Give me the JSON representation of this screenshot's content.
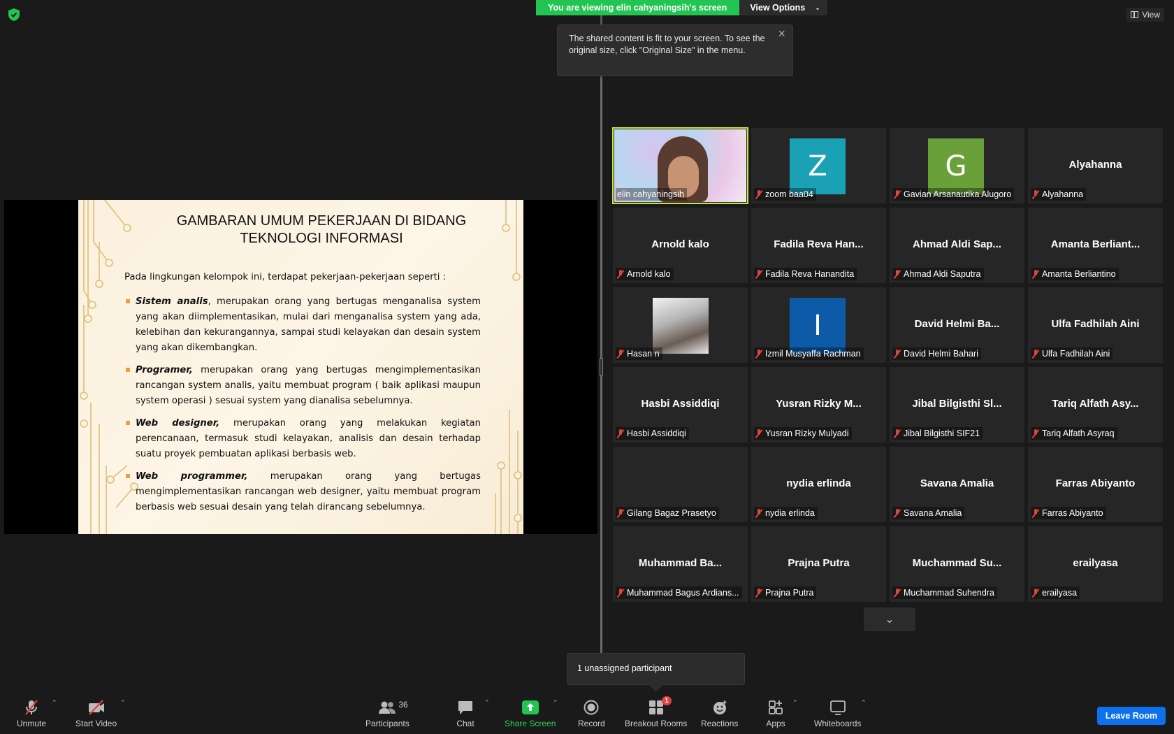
{
  "banner": {
    "viewing_text": "You are viewing elin cahyaningsih's screen",
    "view_options_label": "View Options",
    "view_button_label": "View"
  },
  "tooltip": {
    "text": "The shared content is fit to your screen. To see the original size, click \"Original Size\" in the menu."
  },
  "slide": {
    "title_line1": "GAMBARAN UMUM PEKERJAAN DI BIDANG",
    "title_line2": "TEKNOLOGI INFORMASI",
    "intro": "Pada lingkungan kelompok ini, terdapat pekerjaan-pekerjaan seperti :",
    "bullets": [
      {
        "term": "Sistem analis",
        "text": ", merupakan orang yang bertugas menganalisa system yang akan diimplementasikan, mulai dari menganalisa system yang ada, kelebihan dan kekurangannya, sampai studi kelayakan dan desain system yang akan dikembangkan."
      },
      {
        "term": "Programer,",
        "text": " merupakan orang yang bertugas mengimplementasikan rancangan system analis, yaitu membuat program ( baik aplikasi maupun system operasi ) sesuai system yang dianalisa sebelumnya."
      },
      {
        "term": "Web designer,",
        "text": " merupakan orang yang melakukan kegiatan perencanaan, termasuk studi kelayakan, analisis dan desain terhadap suatu proyek pembuatan aplikasi berbasis web."
      },
      {
        "term": "Web programmer,",
        "text": " merupakan orang yang bertugas mengimplementasikan rancangan web designer, yaitu membuat program berbasis web sesuai desain yang telah dirancang sebelumnya."
      }
    ]
  },
  "participants": [
    {
      "display": "",
      "label": "elin cahyaningsih",
      "type": "video",
      "muted": false,
      "active": true
    },
    {
      "display": "Z",
      "label": "zoom baa04",
      "type": "avatar",
      "color": "#1aa1b5",
      "muted": true
    },
    {
      "display": "G",
      "label": "Gavian Arsanautika Alugoro",
      "type": "avatar",
      "color": "#6aa03a",
      "muted": true
    },
    {
      "display": "Alyahanna",
      "label": "Alyahanna",
      "type": "name",
      "muted": true
    },
    {
      "display": "Arnold kalo",
      "label": "Arnold kalo",
      "type": "name",
      "muted": true
    },
    {
      "display": "Fadila Reva Han...",
      "label": "Fadila Reva Hanandita",
      "type": "name",
      "muted": true
    },
    {
      "display": "Ahmad Aldi Sap...",
      "label": "Ahmad Aldi Saputra",
      "type": "name",
      "muted": true
    },
    {
      "display": "Amanta  Berliant...",
      "label": "Amanta Berliantino",
      "type": "name",
      "muted": true
    },
    {
      "display": "",
      "label": "Hasan n",
      "type": "image",
      "muted": true
    },
    {
      "display": "I",
      "label": "Izmil Musyaffa Rachman",
      "type": "avatar",
      "color": "#0d5ba8",
      "muted": true
    },
    {
      "display": "David Helmi Ba...",
      "label": "David Helmi Bahari",
      "type": "name",
      "muted": true
    },
    {
      "display": "Ulfa Fadhilah Aini",
      "label": "Ulfa Fadhilah Aini",
      "type": "name",
      "muted": true
    },
    {
      "display": "Hasbi Assiddiqi",
      "label": "Hasbi Assiddiqi",
      "type": "name",
      "muted": true
    },
    {
      "display": "Yusran Rizky M...",
      "label": "Yusran Rizky Mulyadi",
      "type": "name",
      "muted": true
    },
    {
      "display": "Jibal Bilgisthi Sl...",
      "label": "Jibal Bilgisthi SIF21",
      "type": "name",
      "muted": true
    },
    {
      "display": "Tariq Alfath Asy...",
      "label": "Tariq Alfath Asyraq",
      "type": "name",
      "muted": true
    },
    {
      "display": "",
      "label": "Gilang Bagaz Prasetyo",
      "type": "blank",
      "muted": true
    },
    {
      "display": "nydia erlinda",
      "label": "nydia erlinda",
      "type": "name",
      "muted": true
    },
    {
      "display": "Savana Amalia",
      "label": "Savana Amalia",
      "type": "name",
      "muted": true
    },
    {
      "display": "Farras Abiyanto",
      "label": "Farras Abiyanto",
      "type": "name",
      "muted": true
    },
    {
      "display": "Muhammad  Ba...",
      "label": "Muhammad Bagus Ardians...",
      "type": "name",
      "muted": true
    },
    {
      "display": "Prajna Putra",
      "label": "Prajna Putra",
      "type": "name",
      "muted": true
    },
    {
      "display": "Muchammad  Su...",
      "label": "Muchammad Suhendra",
      "type": "name",
      "muted": true
    },
    {
      "display": "erailyasa",
      "label": "erailyasa",
      "type": "name",
      "muted": true
    }
  ],
  "unassigned_text": "1 unassigned participant",
  "toolbar": {
    "unmute": "Unmute",
    "start_video": "Start Video",
    "participants": "Participants",
    "participants_count": "36",
    "chat": "Chat",
    "share_screen": "Share Screen",
    "record": "Record",
    "breakout_rooms": "Breakout Rooms",
    "breakout_badge": "1",
    "reactions": "Reactions",
    "apps": "Apps",
    "whiteboards": "Whiteboards",
    "leave_room": "Leave Room"
  },
  "colors": {
    "banner_green": "#23c552",
    "active_outline": "#c4e83b",
    "leave_blue": "#0e71eb",
    "mute_red": "#e0443e",
    "bullet_orange": "#e8a23a"
  }
}
